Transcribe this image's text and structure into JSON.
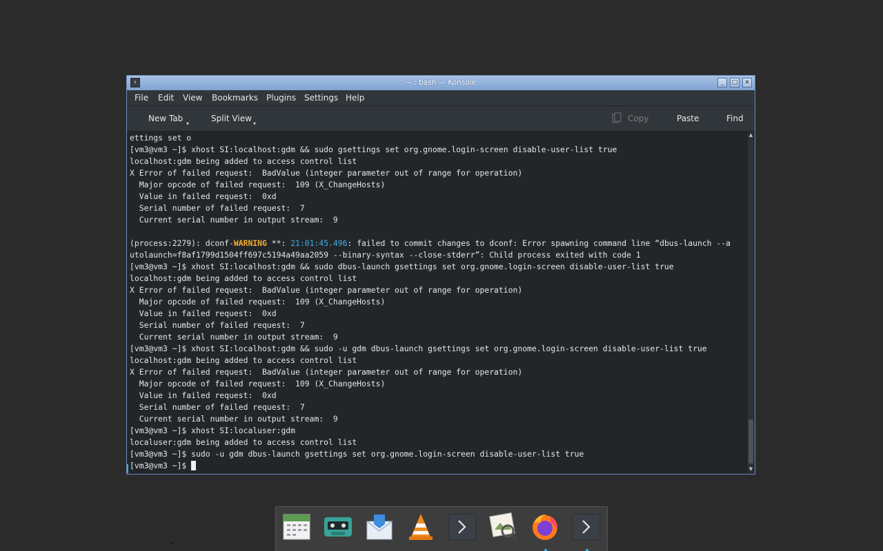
{
  "window": {
    "title": "~ : bash — Konsole",
    "buttons": {
      "minimize": "_",
      "maximize": "□",
      "close": "✕"
    }
  },
  "menubar": [
    "File",
    "Edit",
    "View",
    "Bookmarks",
    "Plugins",
    "Settings",
    "Help"
  ],
  "toolbar": {
    "new_tab": "New Tab",
    "split_view": "Split View",
    "copy": "Copy",
    "paste": "Paste",
    "find": "Find"
  },
  "terminal": {
    "lines": [
      "ettings set o",
      "[vm3@vm3 ~]$ xhost SI:localhost:gdm && sudo gsettings set org.gnome.login-screen disable-user-list true",
      "localhost:gdm being added to access control list",
      "X Error of failed request:  BadValue (integer parameter out of range for operation)",
      "  Major opcode of failed request:  109 (X_ChangeHosts)",
      "  Value in failed request:  0xd",
      "  Serial number of failed request:  7",
      "  Current serial number in output stream:  9",
      "",
      "",
      "utolaunch=f8af1799d1504ff697c5194a49aa2059 --binary-syntax --close-stderr”: Child process exited with code 1",
      "[vm3@vm3 ~]$ xhost SI:localhost:gdm && sudo dbus-launch gsettings set org.gnome.login-screen disable-user-list true",
      "localhost:gdm being added to access control list",
      "X Error of failed request:  BadValue (integer parameter out of range for operation)",
      "  Major opcode of failed request:  109 (X_ChangeHosts)",
      "  Value in failed request:  0xd",
      "  Serial number of failed request:  7",
      "  Current serial number in output stream:  9",
      "[vm3@vm3 ~]$ xhost SI:localhost:gdm && sudo -u gdm dbus-launch gsettings set org.gnome.login-screen disable-user-list true",
      "localhost:gdm being added to access control list",
      "X Error of failed request:  BadValue (integer parameter out of range for operation)",
      "  Major opcode of failed request:  109 (X_ChangeHosts)",
      "  Value in failed request:  0xd",
      "  Serial number of failed request:  7",
      "  Current serial number in output stream:  9",
      "[vm3@vm3 ~]$ xhost SI:localuser:gdm",
      "localuser:gdm being added to access control list",
      "[vm3@vm3 ~]$ sudo -u gdm dbus-launch gsettings set org.gnome.login-screen disable-user-list true"
    ],
    "warning_line": {
      "prefix": "(process:2279): dconf-",
      "level": "WARNING",
      "middle": " **: ",
      "timestamp": "21:01:45.496",
      "suffix": ": failed to commit changes to dconf: Error spawning command line “dbus-launch --a"
    },
    "prompt": "[vm3@vm3 ~]$ "
  },
  "dock": {
    "items": [
      "calendar-icon",
      "cassette-player-icon",
      "mail-icon",
      "vlc-icon",
      "terminal-icon",
      "image-viewer-icon",
      "firefox-icon",
      "terminal-icon-2"
    ]
  },
  "colors": {
    "accent": "#3daee9",
    "warning": "#f6ad2e",
    "terminal_bg": "#232629"
  }
}
